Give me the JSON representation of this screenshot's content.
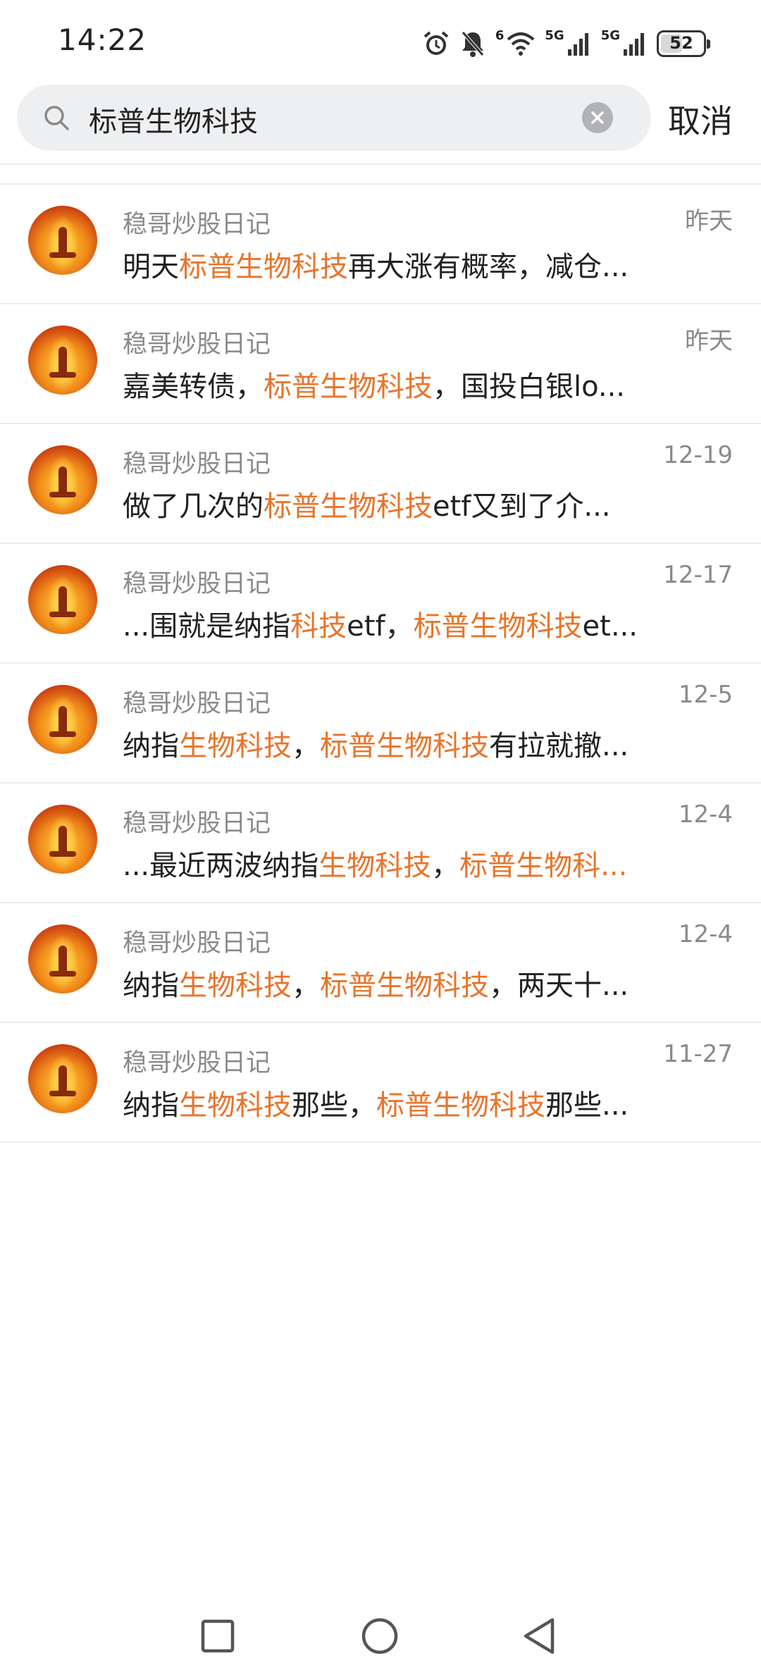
{
  "status_bar": {
    "time": "14:22",
    "net1": "6",
    "net2": "5G",
    "net3": "5G",
    "battery": "52",
    "battery_level": 0.52
  },
  "search": {
    "query": "标普生物科技",
    "cancel_label": "取消"
  },
  "results": [
    {
      "author": "稳哥炒股日记",
      "date": "昨天",
      "parts": [
        {
          "t": "明天",
          "hl": false
        },
        {
          "t": "标普生物科技",
          "hl": true
        },
        {
          "t": "再大涨有概率，减仓...",
          "hl": false
        }
      ]
    },
    {
      "author": "稳哥炒股日记",
      "date": "昨天",
      "parts": [
        {
          "t": "嘉美转债，",
          "hl": false
        },
        {
          "t": "标普生物科技",
          "hl": true
        },
        {
          "t": "，国投白银lo...",
          "hl": false
        }
      ]
    },
    {
      "author": "稳哥炒股日记",
      "date": "12-19",
      "parts": [
        {
          "t": "做了几次的",
          "hl": false
        },
        {
          "t": "标普生物科技",
          "hl": true
        },
        {
          "t": "etf又到了介...",
          "hl": false
        }
      ]
    },
    {
      "author": "稳哥炒股日记",
      "date": "12-17",
      "parts": [
        {
          "t": "...围就是纳指",
          "hl": false
        },
        {
          "t": "科技",
          "hl": true
        },
        {
          "t": "etf，",
          "hl": false
        },
        {
          "t": "标普生物科技",
          "hl": true
        },
        {
          "t": "et...",
          "hl": false
        }
      ]
    },
    {
      "author": "稳哥炒股日记",
      "date": "12-5",
      "parts": [
        {
          "t": "纳指",
          "hl": false
        },
        {
          "t": "生物科技",
          "hl": true
        },
        {
          "t": "，",
          "hl": false
        },
        {
          "t": "标普生物科技",
          "hl": true
        },
        {
          "t": "有拉就撤...",
          "hl": false
        }
      ]
    },
    {
      "author": "稳哥炒股日记",
      "date": "12-4",
      "parts": [
        {
          "t": "...最近两波纳指",
          "hl": false
        },
        {
          "t": "生物科技",
          "hl": true
        },
        {
          "t": "，",
          "hl": false
        },
        {
          "t": "标普生物科...",
          "hl": true
        }
      ]
    },
    {
      "author": "稳哥炒股日记",
      "date": "12-4",
      "parts": [
        {
          "t": "纳指",
          "hl": false
        },
        {
          "t": "生物科技",
          "hl": true
        },
        {
          "t": "，",
          "hl": false
        },
        {
          "t": "标普生物科技",
          "hl": true
        },
        {
          "t": "，两天十...",
          "hl": false
        }
      ]
    },
    {
      "author": "稳哥炒股日记",
      "date": "11-27",
      "parts": [
        {
          "t": "纳指",
          "hl": false
        },
        {
          "t": "生物科技",
          "hl": true
        },
        {
          "t": "那些，",
          "hl": false
        },
        {
          "t": "标普生物科技",
          "hl": true
        },
        {
          "t": "那些...",
          "hl": false
        }
      ]
    }
  ],
  "colors": {
    "highlight": "#e8742a",
    "secondary_text": "#8a8a8a"
  },
  "icons": [
    "alarm-icon",
    "mute-bell-icon",
    "wifi-icon",
    "signal-icon",
    "battery-icon",
    "search-icon",
    "clear-icon",
    "recents-icon",
    "home-icon",
    "back-icon"
  ]
}
